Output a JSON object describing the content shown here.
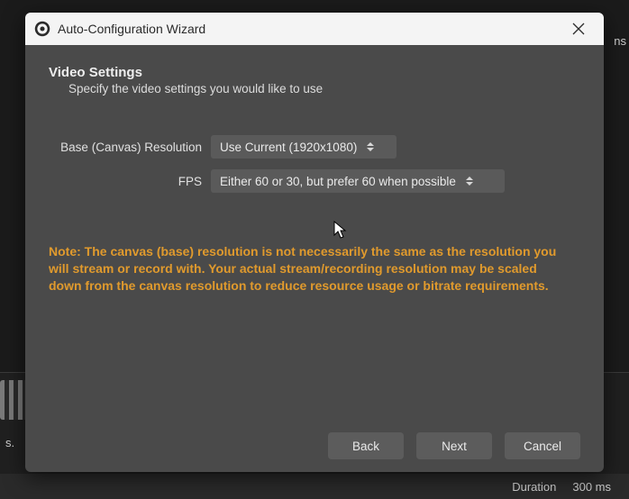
{
  "window": {
    "title": "Auto-Configuration Wizard"
  },
  "page": {
    "heading": "Video Settings",
    "subheading": "Specify the video settings you would like to use"
  },
  "form": {
    "resolution_label": "Base (Canvas) Resolution",
    "resolution_value": "Use Current (1920x1080)",
    "fps_label": "FPS",
    "fps_value": "Either 60 or 30, but prefer 60 when possible"
  },
  "note": "Note: The canvas (base) resolution is not necessarily the same as the resolution you will stream or record with. Your actual stream/recording resolution may be scaled down from the canvas resolution to reduce resource usage or bitrate requirements.",
  "buttons": {
    "back": "Back",
    "next": "Next",
    "cancel": "Cancel"
  },
  "status": {
    "duration_label": "Duration",
    "duration_value": "300 ms"
  },
  "bg_fragments": {
    "side": "s.",
    "right": "ns"
  }
}
